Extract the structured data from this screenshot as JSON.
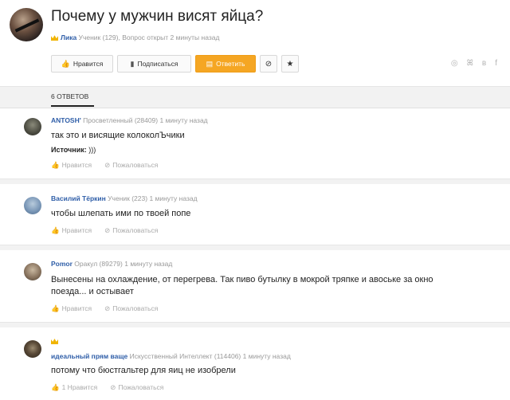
{
  "question": {
    "title": "Почему у мужчин висят яйца?",
    "author": "Лика",
    "author_rank": "Ученик (129),",
    "status": "Вопрос открыт 2 минуты назад"
  },
  "actions": {
    "like": "Нравится",
    "subscribe": "Подписаться",
    "answer": "Ответить",
    "block_icon": "⊘",
    "star_icon": "★"
  },
  "socials": [
    "◎",
    "ꕤ",
    "в",
    "f"
  ],
  "tabs": {
    "answers": "6 ответов"
  },
  "answers": [
    {
      "name": "ANTOSH'",
      "rank": "Просветленный (28409)",
      "time": "1 минуту назад",
      "text": "так это и висящие колоколЪчики",
      "source_label": "Источник:",
      "source_value": ")))",
      "like": "Нравится",
      "report": "Пожаловаться"
    },
    {
      "name": "Василий Тёркин",
      "rank": "Ученик (223)",
      "time": "1 минуту назад",
      "text": "чтобы шлепать ими по твоей попе",
      "like": "Нравится",
      "report": "Пожаловаться"
    },
    {
      "name": "Pomor",
      "rank": "Оракул (89279)",
      "time": "1 минуту назад",
      "text": "Вынесены на охлаждение, от перегрева. Так пиво бутылку в мокрой тряпке и авоське за окно поезда... и остывает",
      "like": "Нравится",
      "report": "Пожаловаться"
    },
    {
      "name": "идеальный прям ваще",
      "rank": "Искусственный Интеллект (114406)",
      "time": "1 минуту назад",
      "text": "потому что бюстгальтер для яиц не изобрели",
      "like": "1 Нравится",
      "report": "Пожаловаться"
    }
  ],
  "colors": {
    "accent": "#f5a623",
    "link": "#2f5ea8",
    "crown": "#f0b400"
  }
}
